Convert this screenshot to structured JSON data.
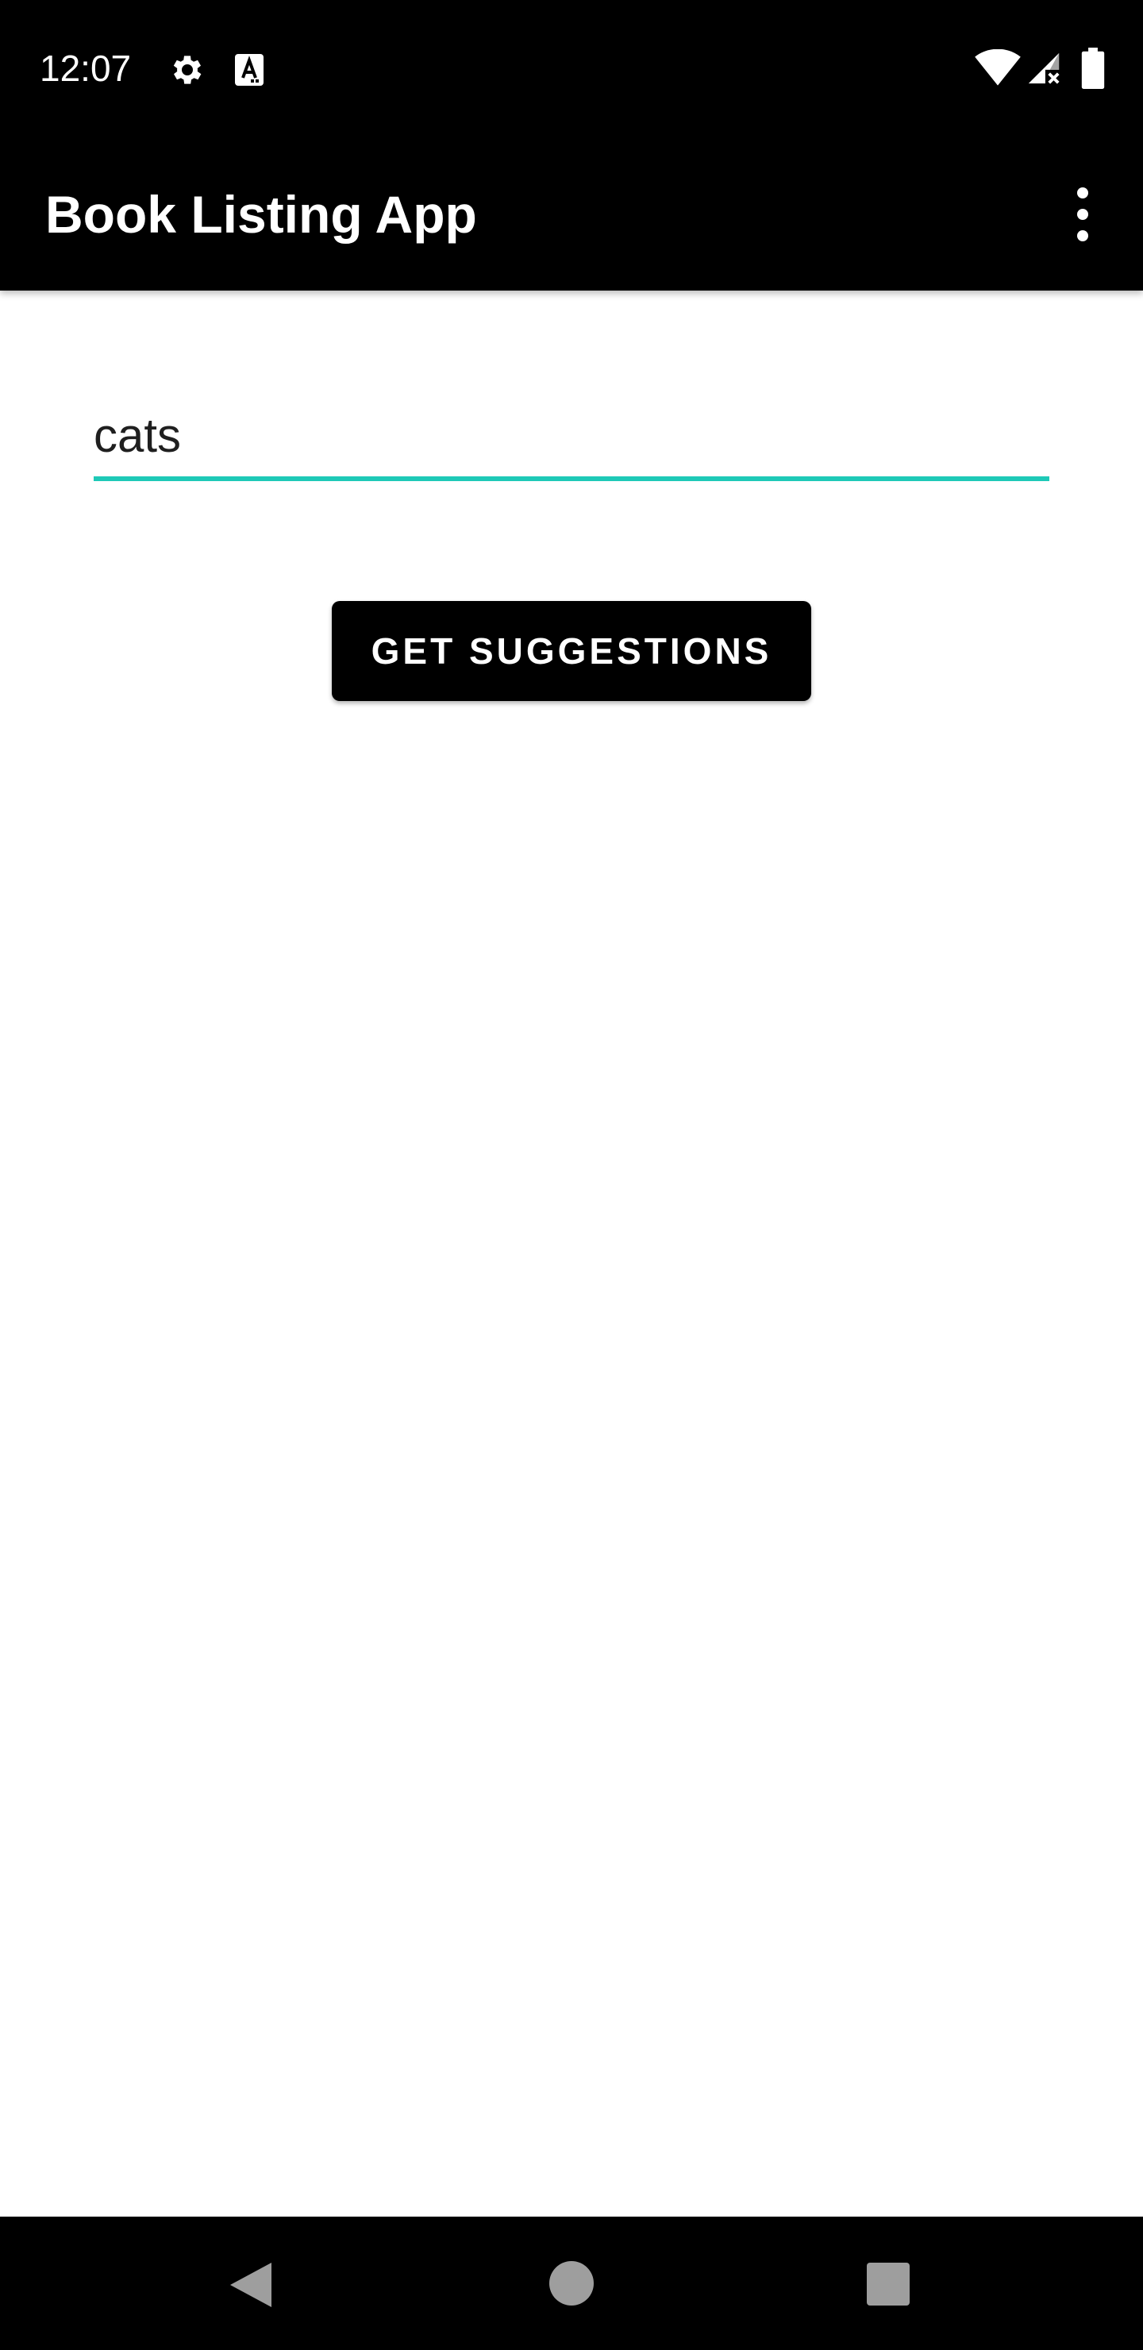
{
  "status_bar": {
    "time": "12:07",
    "icons": [
      "settings-gear-icon",
      "a-notification-icon",
      "wifi-icon",
      "signal-icon",
      "battery-icon"
    ]
  },
  "app_bar": {
    "title": "Book Listing App",
    "menu_icon": "more-vert-icon"
  },
  "search": {
    "value": "cats",
    "underline_color": "#1ec9b7"
  },
  "actions": {
    "get_suggestions_label": "GET SUGGESTIONS"
  },
  "nav_bar": {
    "icons": [
      "back-icon",
      "home-icon",
      "recents-icon"
    ]
  },
  "colors": {
    "app_bar": "#000000",
    "accent": "#1ec9b7",
    "button": "#000000"
  }
}
